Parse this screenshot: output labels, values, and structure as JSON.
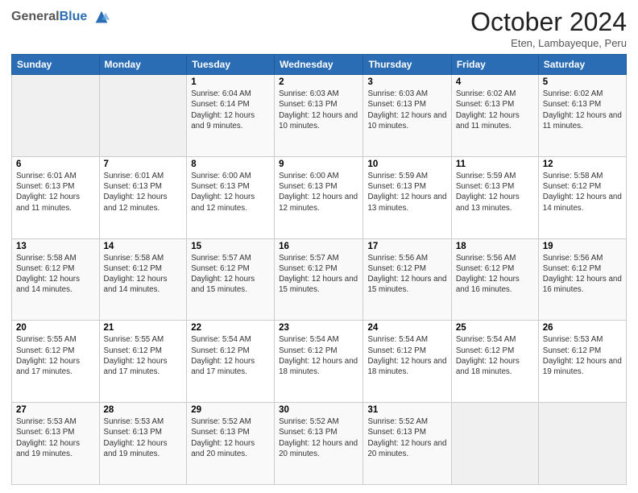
{
  "header": {
    "title": "October 2024",
    "location": "Eten, Lambayeque, Peru"
  },
  "calendar": {
    "days": [
      "Sunday",
      "Monday",
      "Tuesday",
      "Wednesday",
      "Thursday",
      "Friday",
      "Saturday"
    ]
  },
  "weeks": [
    [
      {
        "day": "",
        "info": ""
      },
      {
        "day": "",
        "info": ""
      },
      {
        "day": "1",
        "info": "Sunrise: 6:04 AM\nSunset: 6:14 PM\nDaylight: 12 hours and 9 minutes."
      },
      {
        "day": "2",
        "info": "Sunrise: 6:03 AM\nSunset: 6:13 PM\nDaylight: 12 hours and 10 minutes."
      },
      {
        "day": "3",
        "info": "Sunrise: 6:03 AM\nSunset: 6:13 PM\nDaylight: 12 hours and 10 minutes."
      },
      {
        "day": "4",
        "info": "Sunrise: 6:02 AM\nSunset: 6:13 PM\nDaylight: 12 hours and 11 minutes."
      },
      {
        "day": "5",
        "info": "Sunrise: 6:02 AM\nSunset: 6:13 PM\nDaylight: 12 hours and 11 minutes."
      }
    ],
    [
      {
        "day": "6",
        "info": "Sunrise: 6:01 AM\nSunset: 6:13 PM\nDaylight: 12 hours and 11 minutes."
      },
      {
        "day": "7",
        "info": "Sunrise: 6:01 AM\nSunset: 6:13 PM\nDaylight: 12 hours and 12 minutes."
      },
      {
        "day": "8",
        "info": "Sunrise: 6:00 AM\nSunset: 6:13 PM\nDaylight: 12 hours and 12 minutes."
      },
      {
        "day": "9",
        "info": "Sunrise: 6:00 AM\nSunset: 6:13 PM\nDaylight: 12 hours and 12 minutes."
      },
      {
        "day": "10",
        "info": "Sunrise: 5:59 AM\nSunset: 6:13 PM\nDaylight: 12 hours and 13 minutes."
      },
      {
        "day": "11",
        "info": "Sunrise: 5:59 AM\nSunset: 6:13 PM\nDaylight: 12 hours and 13 minutes."
      },
      {
        "day": "12",
        "info": "Sunrise: 5:58 AM\nSunset: 6:12 PM\nDaylight: 12 hours and 14 minutes."
      }
    ],
    [
      {
        "day": "13",
        "info": "Sunrise: 5:58 AM\nSunset: 6:12 PM\nDaylight: 12 hours and 14 minutes."
      },
      {
        "day": "14",
        "info": "Sunrise: 5:58 AM\nSunset: 6:12 PM\nDaylight: 12 hours and 14 minutes."
      },
      {
        "day": "15",
        "info": "Sunrise: 5:57 AM\nSunset: 6:12 PM\nDaylight: 12 hours and 15 minutes."
      },
      {
        "day": "16",
        "info": "Sunrise: 5:57 AM\nSunset: 6:12 PM\nDaylight: 12 hours and 15 minutes."
      },
      {
        "day": "17",
        "info": "Sunrise: 5:56 AM\nSunset: 6:12 PM\nDaylight: 12 hours and 15 minutes."
      },
      {
        "day": "18",
        "info": "Sunrise: 5:56 AM\nSunset: 6:12 PM\nDaylight: 12 hours and 16 minutes."
      },
      {
        "day": "19",
        "info": "Sunrise: 5:56 AM\nSunset: 6:12 PM\nDaylight: 12 hours and 16 minutes."
      }
    ],
    [
      {
        "day": "20",
        "info": "Sunrise: 5:55 AM\nSunset: 6:12 PM\nDaylight: 12 hours and 17 minutes."
      },
      {
        "day": "21",
        "info": "Sunrise: 5:55 AM\nSunset: 6:12 PM\nDaylight: 12 hours and 17 minutes."
      },
      {
        "day": "22",
        "info": "Sunrise: 5:54 AM\nSunset: 6:12 PM\nDaylight: 12 hours and 17 minutes."
      },
      {
        "day": "23",
        "info": "Sunrise: 5:54 AM\nSunset: 6:12 PM\nDaylight: 12 hours and 18 minutes."
      },
      {
        "day": "24",
        "info": "Sunrise: 5:54 AM\nSunset: 6:12 PM\nDaylight: 12 hours and 18 minutes."
      },
      {
        "day": "25",
        "info": "Sunrise: 5:54 AM\nSunset: 6:12 PM\nDaylight: 12 hours and 18 minutes."
      },
      {
        "day": "26",
        "info": "Sunrise: 5:53 AM\nSunset: 6:12 PM\nDaylight: 12 hours and 19 minutes."
      }
    ],
    [
      {
        "day": "27",
        "info": "Sunrise: 5:53 AM\nSunset: 6:13 PM\nDaylight: 12 hours and 19 minutes."
      },
      {
        "day": "28",
        "info": "Sunrise: 5:53 AM\nSunset: 6:13 PM\nDaylight: 12 hours and 19 minutes."
      },
      {
        "day": "29",
        "info": "Sunrise: 5:52 AM\nSunset: 6:13 PM\nDaylight: 12 hours and 20 minutes."
      },
      {
        "day": "30",
        "info": "Sunrise: 5:52 AM\nSunset: 6:13 PM\nDaylight: 12 hours and 20 minutes."
      },
      {
        "day": "31",
        "info": "Sunrise: 5:52 AM\nSunset: 6:13 PM\nDaylight: 12 hours and 20 minutes."
      },
      {
        "day": "",
        "info": ""
      },
      {
        "day": "",
        "info": ""
      }
    ]
  ]
}
